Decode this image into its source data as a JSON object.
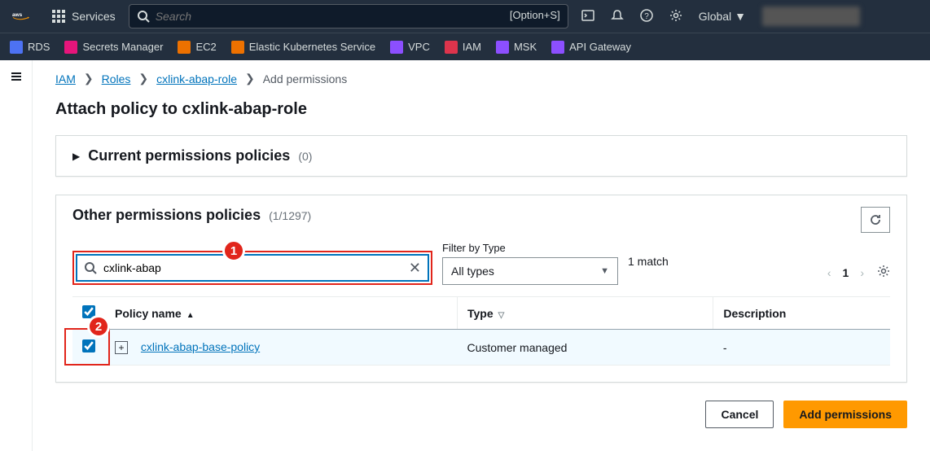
{
  "top_nav": {
    "services_label": "Services",
    "search_placeholder": "Search",
    "search_shortcut": "[Option+S]",
    "region": "Global"
  },
  "service_bar": [
    {
      "label": "RDS",
      "color": "#4d72f3"
    },
    {
      "label": "Secrets Manager",
      "color": "#e7157b"
    },
    {
      "label": "EC2",
      "color": "#ed7100"
    },
    {
      "label": "Elastic Kubernetes Service",
      "color": "#ed7100"
    },
    {
      "label": "VPC",
      "color": "#8c4fff"
    },
    {
      "label": "IAM",
      "color": "#dd344c"
    },
    {
      "label": "MSK",
      "color": "#8c4fff"
    },
    {
      "label": "API Gateway",
      "color": "#8c4fff"
    }
  ],
  "breadcrumb": {
    "items": [
      "IAM",
      "Roles",
      "cxlink-abap-role"
    ],
    "current": "Add permissions"
  },
  "page_title": "Attach policy to cxlink-abap-role",
  "current_policies": {
    "title": "Current permissions policies",
    "count": "(0)"
  },
  "other_policies": {
    "title": "Other permissions policies",
    "count": "(1/1297)",
    "filter_label": "Filter by Type",
    "filter_value": "cxlink-abap",
    "type_select": "All types",
    "match_text": "1 match",
    "page_num": "1",
    "columns": {
      "name": "Policy name",
      "type": "Type",
      "desc": "Description"
    },
    "rows": [
      {
        "checked": true,
        "name": "cxlink-abap-base-policy",
        "type": "Customer managed",
        "desc": "-"
      }
    ]
  },
  "footer": {
    "cancel": "Cancel",
    "add": "Add permissions"
  },
  "callouts": {
    "one": "1",
    "two": "2"
  }
}
